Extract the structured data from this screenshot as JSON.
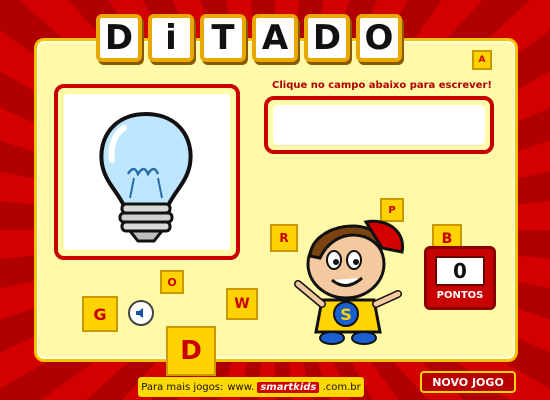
{
  "title_letters": [
    "D",
    "i",
    "T",
    "A",
    "D",
    "O"
  ],
  "instruction": "Clique no campo abaixo para escrever!",
  "answer": {
    "value": "",
    "placeholder": ""
  },
  "score": {
    "value": "0",
    "label": "PONTOS"
  },
  "new_game_label": "NOVO JOGO",
  "footer": {
    "prefix": "Para mais jogos:",
    "link_prefix": "www.",
    "brand": "smartkids",
    "suffix": ".com.br"
  },
  "image_subject": "light-bulb",
  "cube_letters": [
    "G",
    "D",
    "W",
    "O",
    "R",
    "B",
    "P",
    "A"
  ],
  "colors": {
    "background": "#c40000",
    "panel": "#fff9a8",
    "frame": "#c80000",
    "tile_border": "#e9a800",
    "cube": "#ffd200"
  },
  "icons": [
    "sound-icon",
    "light-bulb-icon"
  ]
}
